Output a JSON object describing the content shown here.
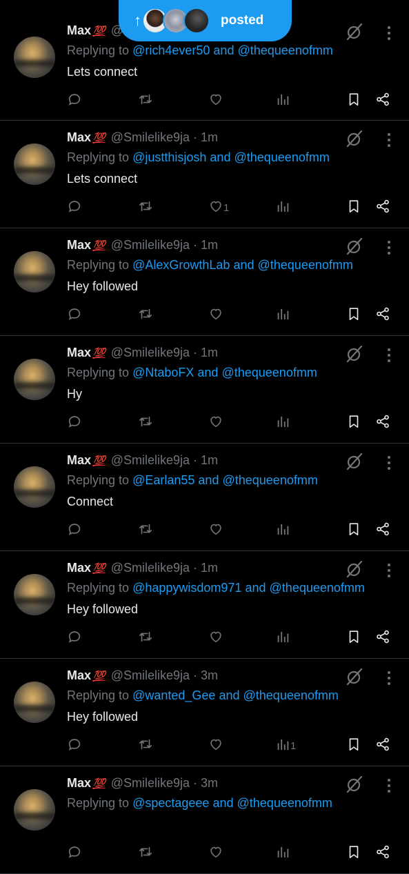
{
  "posted_pill": {
    "arrow": "↑",
    "label": "posted",
    "avatars": [
      "avatar-1",
      "avatar-2",
      "avatar-3"
    ]
  },
  "tweets": [
    {
      "name": "Max",
      "emoji": "💯",
      "handle": "@",
      "time": "",
      "replying_prefix": "Replying to",
      "mention1": "@rich4ever50",
      "and": "and",
      "mention2": "@thequeenofmm",
      "text": "Lets connect",
      "likes": "",
      "views": ""
    },
    {
      "name": "Max",
      "emoji": "💯",
      "handle": "@Smilelike9ja",
      "time": "· 1m",
      "replying_prefix": "Replying to",
      "mention1": "@justthisjosh",
      "and": "and",
      "mention2": "@thequeenofmm",
      "text": "Lets connect",
      "likes": "1",
      "views": ""
    },
    {
      "name": "Max",
      "emoji": "💯",
      "handle": "@Smilelike9ja",
      "time": "· 1m",
      "replying_prefix": "Replying to",
      "mention1": "@AlexGrowthLab",
      "and": "and",
      "mention2": "@thequeenofmm",
      "text": "Hey followed",
      "likes": "",
      "views": ""
    },
    {
      "name": "Max",
      "emoji": "💯",
      "handle": "@Smilelike9ja",
      "time": "· 1m",
      "replying_prefix": "Replying to",
      "mention1": "@NtaboFX",
      "and": "and",
      "mention2": "@thequeenofmm",
      "text": "Hy",
      "likes": "",
      "views": ""
    },
    {
      "name": "Max",
      "emoji": "💯",
      "handle": "@Smilelike9ja",
      "time": "· 1m",
      "replying_prefix": "Replying to",
      "mention1": "@Earlan55",
      "and": "and",
      "mention2": "@thequeenofmm",
      "text": "Connect",
      "likes": "",
      "views": ""
    },
    {
      "name": "Max",
      "emoji": "💯",
      "handle": "@Smilelike9ja",
      "time": "· 1m",
      "replying_prefix": "Replying to",
      "mention1": "@happywisdom971",
      "and": "and",
      "mention2": "@thequeenofmm",
      "text": "Hey followed",
      "likes": "",
      "views": ""
    },
    {
      "name": "Max",
      "emoji": "💯",
      "handle": "@Smilelike9ja",
      "time": "· 3m",
      "replying_prefix": "Replying to",
      "mention1": "@wanted_Gee",
      "and": "and",
      "mention2": "@thequeenofmm",
      "text": "Hey followed",
      "likes": "",
      "views": "1"
    },
    {
      "name": "Max",
      "emoji": "💯",
      "handle": "@Smilelike9ja",
      "time": "· 3m",
      "replying_prefix": "Replying to",
      "mention1": "@spectageee",
      "and": "and",
      "mention2": "@thequeenofmm",
      "text": "",
      "likes": "",
      "views": ""
    }
  ],
  "icons": {
    "reply": "reply-icon",
    "retweet": "retweet-icon",
    "like": "heart-icon",
    "views": "views-icon",
    "bookmark": "bookmark-icon",
    "share": "share-icon",
    "grok": "grok-icon",
    "more": "more-vertical-icon"
  },
  "colors": {
    "background": "#000000",
    "accent": "#1d9bf0",
    "muted": "#71767b",
    "text": "#e7e9ea"
  }
}
